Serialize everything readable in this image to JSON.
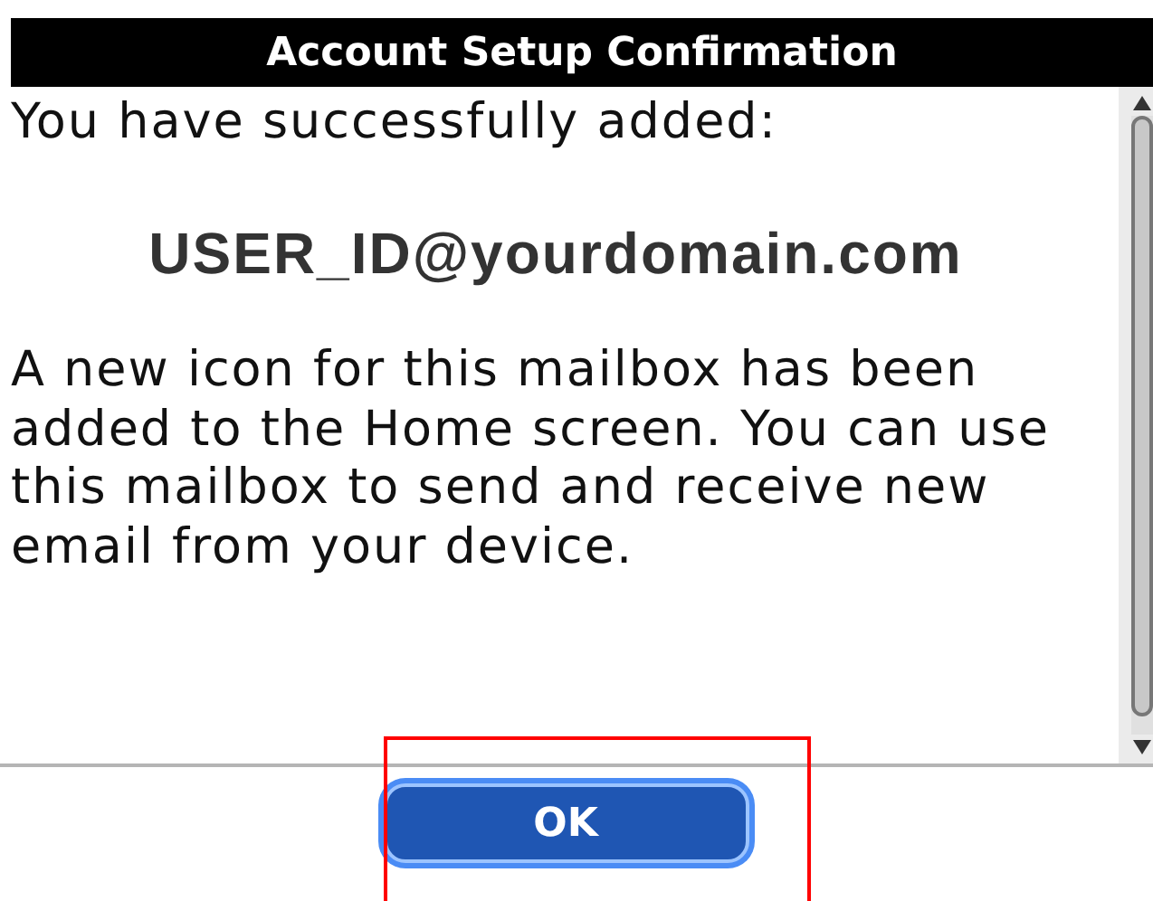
{
  "dialog": {
    "title": "Account Setup Confirmation",
    "intro": "You have successfully added:",
    "account": "USER_ID@yourdomain.com",
    "message": "A new icon for this mailbox has been added to the Home screen. You can use this mailbox to send and receive new email from your device.",
    "scrollbar": {
      "level": 0.97
    },
    "buttons": [
      {
        "label": "OK",
        "selected": true,
        "highlighted": true
      }
    ]
  }
}
